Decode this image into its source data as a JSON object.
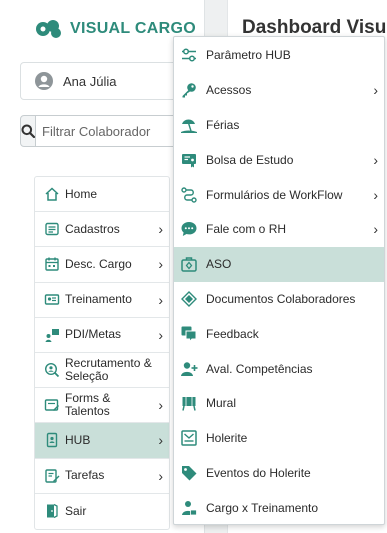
{
  "logo": {
    "text": "VISUAL CARGO"
  },
  "user": {
    "name": "Ana Júlia"
  },
  "search": {
    "placeholder": "Filtrar Colaborador"
  },
  "dashboard": {
    "title": "Dashboard Visu"
  },
  "sidebar": {
    "items": [
      {
        "label": "Home",
        "icon": "home-icon",
        "chevron": ""
      },
      {
        "label": "Cadastros",
        "icon": "list-icon",
        "chevron": "›"
      },
      {
        "label": "Desc. Cargo",
        "icon": "calendar-icon",
        "chevron": "›"
      },
      {
        "label": "Treinamento",
        "icon": "presentation-icon",
        "chevron": "›"
      },
      {
        "label": "PDI/Metas",
        "icon": "goals-icon",
        "chevron": "›"
      },
      {
        "label": "Recrutamento & Seleção",
        "icon": "search-person-icon",
        "chevron": ""
      },
      {
        "label": "Forms & Talentos",
        "icon": "form-icon",
        "chevron": "›"
      },
      {
        "label": "HUB",
        "icon": "hub-icon",
        "chevron": "›"
      },
      {
        "label": "Tarefas",
        "icon": "tasks-icon",
        "chevron": "›"
      },
      {
        "label": "Sair",
        "icon": "logout-icon",
        "chevron": ""
      }
    ]
  },
  "hub_menu": {
    "items": [
      {
        "label": "Parâmetro HUB",
        "icon": "sliders-icon",
        "chevron": ""
      },
      {
        "label": "Acessos",
        "icon": "key-icon",
        "chevron": "›"
      },
      {
        "label": "Férias",
        "icon": "beach-icon",
        "chevron": ""
      },
      {
        "label": "Bolsa de Estudo",
        "icon": "study-icon",
        "chevron": "›"
      },
      {
        "label": "Formulários de WorkFlow",
        "icon": "workflow-icon",
        "chevron": "›"
      },
      {
        "label": "Fale com o RH",
        "icon": "chat-icon",
        "chevron": "›"
      },
      {
        "label": "ASO",
        "icon": "medical-box-icon",
        "chevron": ""
      },
      {
        "label": "Documentos Colaboradores",
        "icon": "documents-icon",
        "chevron": ""
      },
      {
        "label": "Feedback",
        "icon": "feedback-icon",
        "chevron": ""
      },
      {
        "label": "Aval. Competências",
        "icon": "evaluation-icon",
        "chevron": ""
      },
      {
        "label": "Mural",
        "icon": "board-icon",
        "chevron": ""
      },
      {
        "label": "Holerite",
        "icon": "payslip-icon",
        "chevron": ""
      },
      {
        "label": "Eventos do Holerite",
        "icon": "tag-icon",
        "chevron": ""
      },
      {
        "label": "Cargo x Treinamento",
        "icon": "user-training-icon",
        "chevron": ""
      }
    ]
  },
  "colors": {
    "brand": "#2e8b7b",
    "active": "#c9dfd9",
    "icon": "#2e8b7b"
  }
}
